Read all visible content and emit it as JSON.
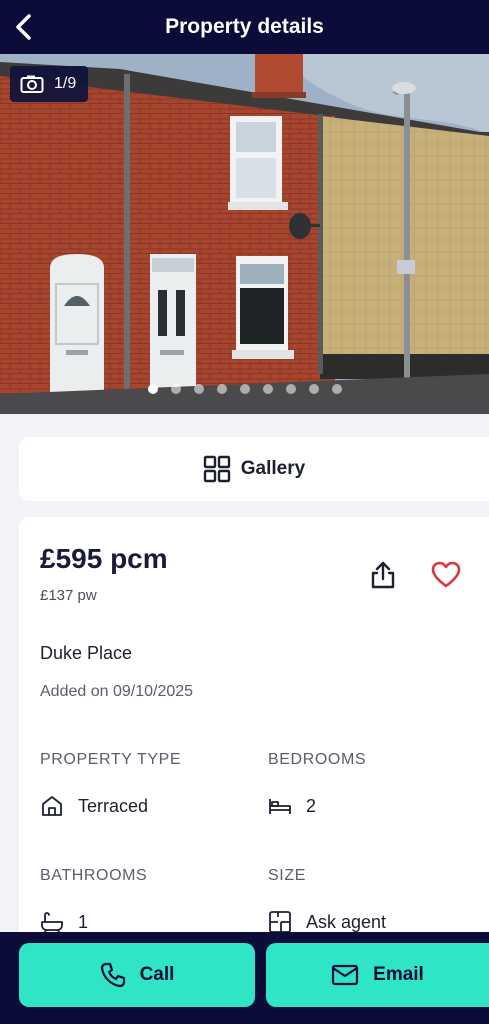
{
  "header": {
    "title": "Property details",
    "back_icon": "chevron-left-icon"
  },
  "photo": {
    "counter": "1/9",
    "camera_icon": "camera-icon",
    "total_dots": 9,
    "active_dot": 0
  },
  "gallery": {
    "label": "Gallery",
    "icon": "grid-icon"
  },
  "listing": {
    "price": "£595 pcm",
    "price_weekly": "£137 pw",
    "address": "Duke Place",
    "added": "Added on 09/10/2025",
    "share_icon": "share-icon",
    "favourite_icon": "heart-icon",
    "favourite_color": "#d9363e"
  },
  "attributes": {
    "property_type": {
      "label": "PROPERTY TYPE",
      "value": "Terraced",
      "icon": "house-icon"
    },
    "bedrooms": {
      "label": "BEDROOMS",
      "value": "2",
      "icon": "bed-icon"
    },
    "bathrooms": {
      "label": "BATHROOMS",
      "value": "1",
      "icon": "bath-icon"
    },
    "size": {
      "label": "SIZE",
      "value": "Ask agent",
      "icon": "floorplan-icon"
    }
  },
  "actions": {
    "call_label": "Call",
    "email_label": "Email",
    "accent": "#2ee6c6",
    "navy": "#0c0c3a"
  }
}
